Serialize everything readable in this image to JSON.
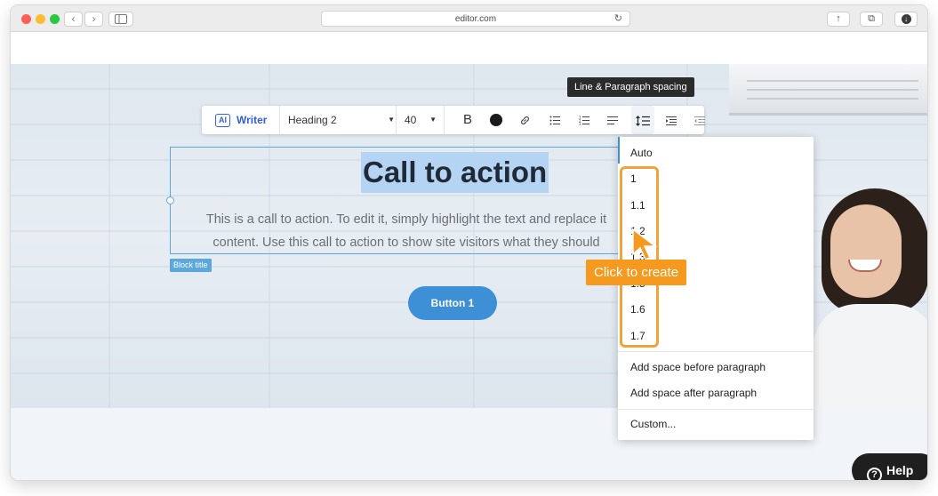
{
  "browser": {
    "url": "editor.com",
    "back_glyph": "‹",
    "forward_glyph": "›",
    "reload_glyph": "↻",
    "share_glyph": "↑",
    "tabs_glyph": "⧉",
    "download_glyph": "↓"
  },
  "toolbar": {
    "ai_badge": "AI",
    "writer_label": "Writer",
    "style_select": "Heading 2",
    "font_size": "40",
    "bold_label": "B",
    "text_color": "#1a1a1a",
    "icons": [
      "link-icon",
      "bulleted-list-icon",
      "numbered-list-icon",
      "align-icon",
      "line-spacing-icon",
      "indent-icon",
      "outdent-icon"
    ]
  },
  "tooltip": "Line & Paragraph spacing",
  "block": {
    "heading": "Call to action",
    "body_line1": "This is a call to action. To edit it, simply highlight the text and replace it",
    "body_line2": "content. Use this call to action to show site visitors what they should",
    "tag": "Block title",
    "button_label": "Button 1"
  },
  "dropdown": {
    "items": [
      "Auto",
      "1",
      "1.1",
      "1.2",
      "1.3",
      "1.5",
      "1.6",
      "1.7"
    ],
    "space_before": "Add space before paragraph",
    "space_after": "Add space after paragraph",
    "custom": "Custom..."
  },
  "callout": "Click to create",
  "help": {
    "icon": "?",
    "label": "Help"
  },
  "colors": {
    "accent": "#3d8fd6",
    "highlight": "#f0a23b",
    "callout": "#f59a1e",
    "selection": "#b5d3f2"
  }
}
